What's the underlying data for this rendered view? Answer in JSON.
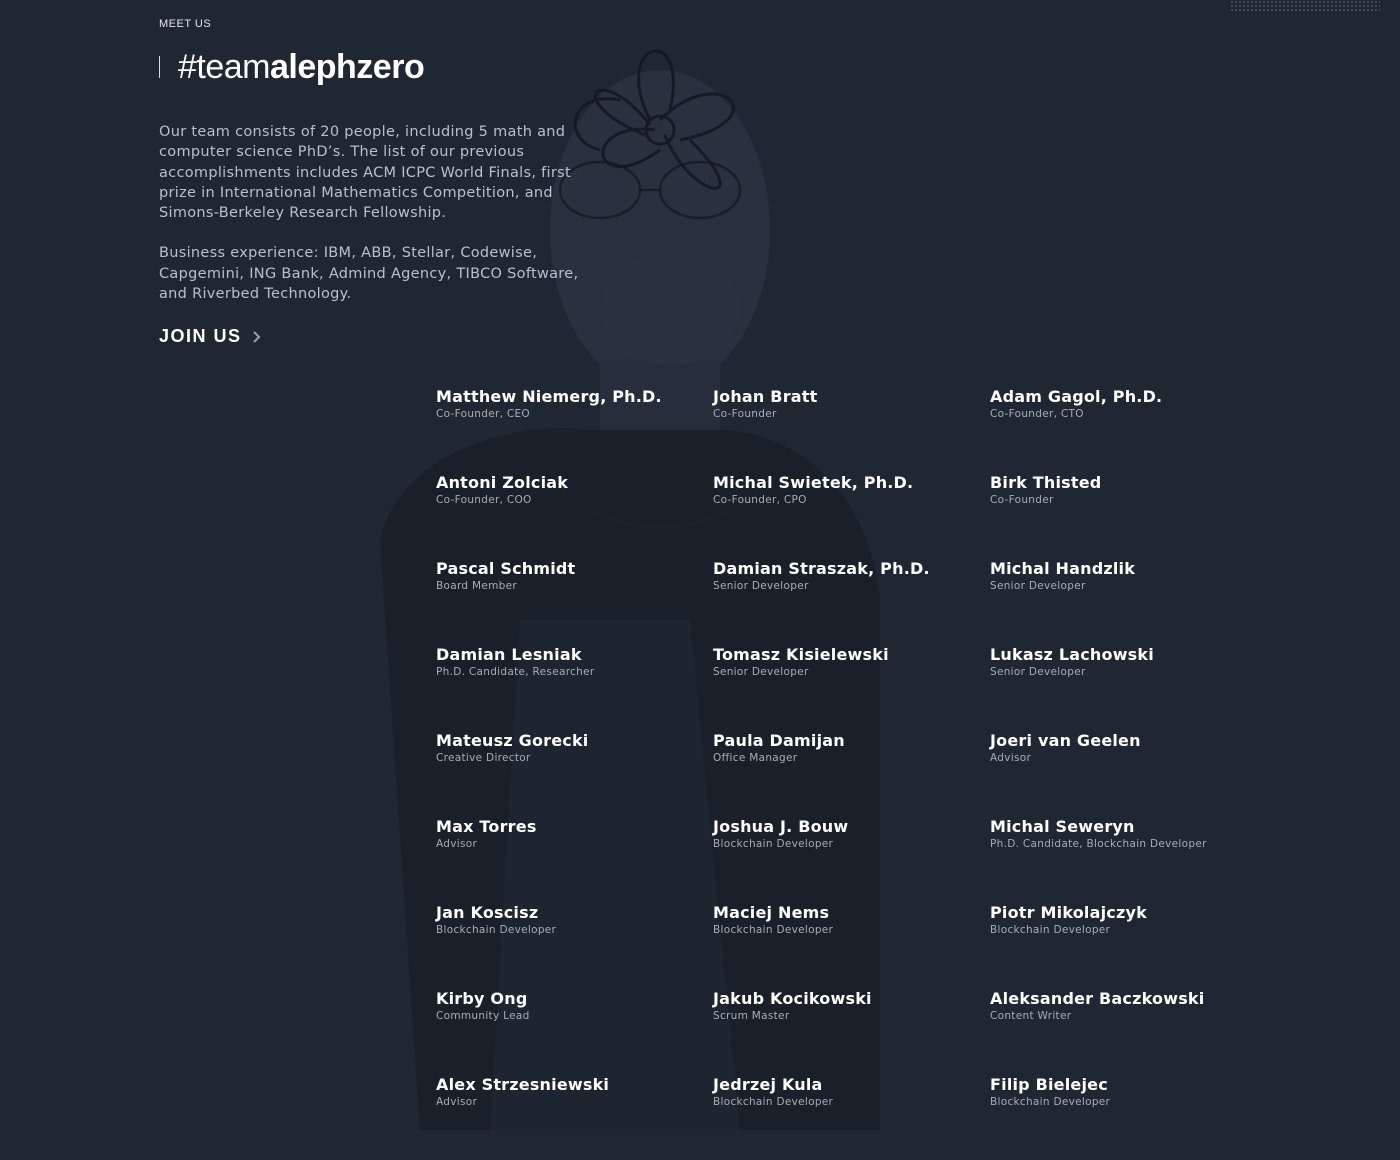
{
  "intro": {
    "eyebrow": "MEET US",
    "title_light": "#team",
    "title_bold": "alephzero",
    "paragraph1": "Our team consists of 20 people, including 5 math and computer science PhD’s. The list of our previous accomplishments includes ACM ICPC World Finals, first prize in International Mathematics Competition, and Simons-Berkeley Research Fellowship.",
    "paragraph2": "Business experience: IBM, ABB, Stellar, Codewise, Capgemini, ING Bank, Admind Agency, TIBCO Software, and Riverbed Technology.",
    "join_label": "JOIN US",
    "join_icon": "chevron-right-icon"
  },
  "team": [
    {
      "name": "Matthew Niemerg, Ph.D.",
      "role": "Co-Founder, CEO"
    },
    {
      "name": "Johan Bratt",
      "role": "Co-Founder"
    },
    {
      "name": "Adam Gagol, Ph.D.",
      "role": "Co-Founder, CTO"
    },
    {
      "name": "Antoni Zolciak",
      "role": "Co-Founder, COO"
    },
    {
      "name": "Michal Swietek, Ph.D.",
      "role": "Co-Founder, CPO"
    },
    {
      "name": "Birk Thisted",
      "role": "Co-Founder"
    },
    {
      "name": "Pascal Schmidt",
      "role": "Board Member"
    },
    {
      "name": "Damian Straszak, Ph.D.",
      "role": "Senior Developer"
    },
    {
      "name": "Michal Handzlik",
      "role": "Senior Developer"
    },
    {
      "name": "Damian Lesniak",
      "role": "Ph.D. Candidate, Researcher"
    },
    {
      "name": "Tomasz Kisielewski",
      "role": "Senior Developer"
    },
    {
      "name": "Lukasz Lachowski",
      "role": "Senior Developer"
    },
    {
      "name": "Mateusz Gorecki",
      "role": "Creative Director"
    },
    {
      "name": "Paula Damijan",
      "role": "Office Manager"
    },
    {
      "name": "Joeri van Geelen",
      "role": "Advisor"
    },
    {
      "name": "Max Torres",
      "role": "Advisor"
    },
    {
      "name": "Joshua J. Bouw",
      "role": "Blockchain Developer"
    },
    {
      "name": "Michal Seweryn",
      "role": "Ph.D. Candidate, Blockchain Developer"
    },
    {
      "name": "Jan Koscisz",
      "role": "Blockchain Developer"
    },
    {
      "name": "Maciej Nems",
      "role": "Blockchain Developer"
    },
    {
      "name": "Piotr Mikolajczyk",
      "role": "Blockchain Developer"
    },
    {
      "name": "Kirby Ong",
      "role": "Community Lead"
    },
    {
      "name": "Jakub Kocikowski",
      "role": "Scrum Master"
    },
    {
      "name": "Aleksander Baczkowski",
      "role": "Content Writer"
    },
    {
      "name": "Alex Strzesniewski",
      "role": "Advisor"
    },
    {
      "name": "Jedrzej Kula",
      "role": "Blockchain Developer"
    },
    {
      "name": "Filip Bielejec",
      "role": "Blockchain Developer"
    }
  ],
  "colors": {
    "background": "#1f2733",
    "text_primary": "#ffffff",
    "text_secondary": "#a4adb9",
    "paragraph": "#b8c0cc"
  }
}
